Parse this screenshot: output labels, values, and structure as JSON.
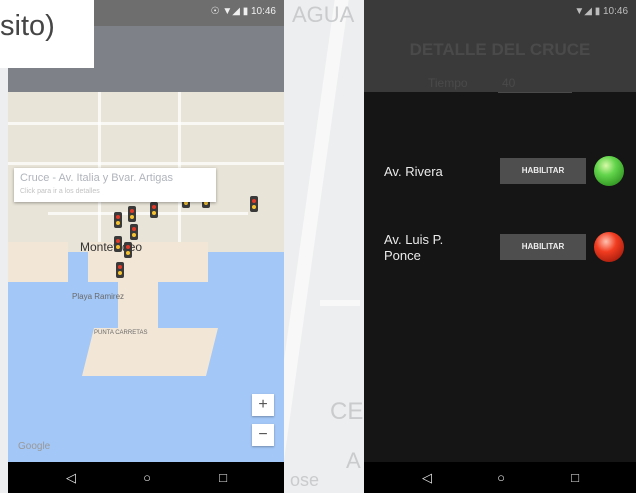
{
  "title": "sito)",
  "background_words": [
    "AGUA",
    "CE",
    "A",
    "ose"
  ],
  "left_phone": {
    "status_time": "☉ ▼◢ ▮ 10:46",
    "info_window": {
      "title": "Cruce - Av. Italia y Bvar. Artigas",
      "subtitle": "Click para ir a los detalles"
    },
    "city_label": "Montevideo",
    "map_labels": [
      "Playa Ramirez",
      "PUNTA CARRETAS"
    ],
    "zoom_in": "+",
    "zoom_out": "−",
    "attribution": "Google",
    "nav": {
      "back": "◁",
      "home": "○",
      "recent": "□"
    }
  },
  "right_phone": {
    "status_time": "▼◢ ▮ 10:46",
    "header_title": "DETALLE DEL CRUCE",
    "time_label": "Tiempo",
    "time_value": "40",
    "rows": [
      {
        "label_line1": "Av. Rivera",
        "label_line2": "",
        "button": "HABILITAR",
        "light": "green"
      },
      {
        "label_line1": "Av. Luis P.",
        "label_line2": "Ponce",
        "button": "HABILITAR",
        "light": "red"
      }
    ],
    "nav": {
      "back": "◁",
      "home": "○",
      "recent": "□"
    }
  },
  "colors": {
    "green_light": "#4cc93a",
    "red_light": "#e8321b",
    "water": "#a3c7f6"
  }
}
